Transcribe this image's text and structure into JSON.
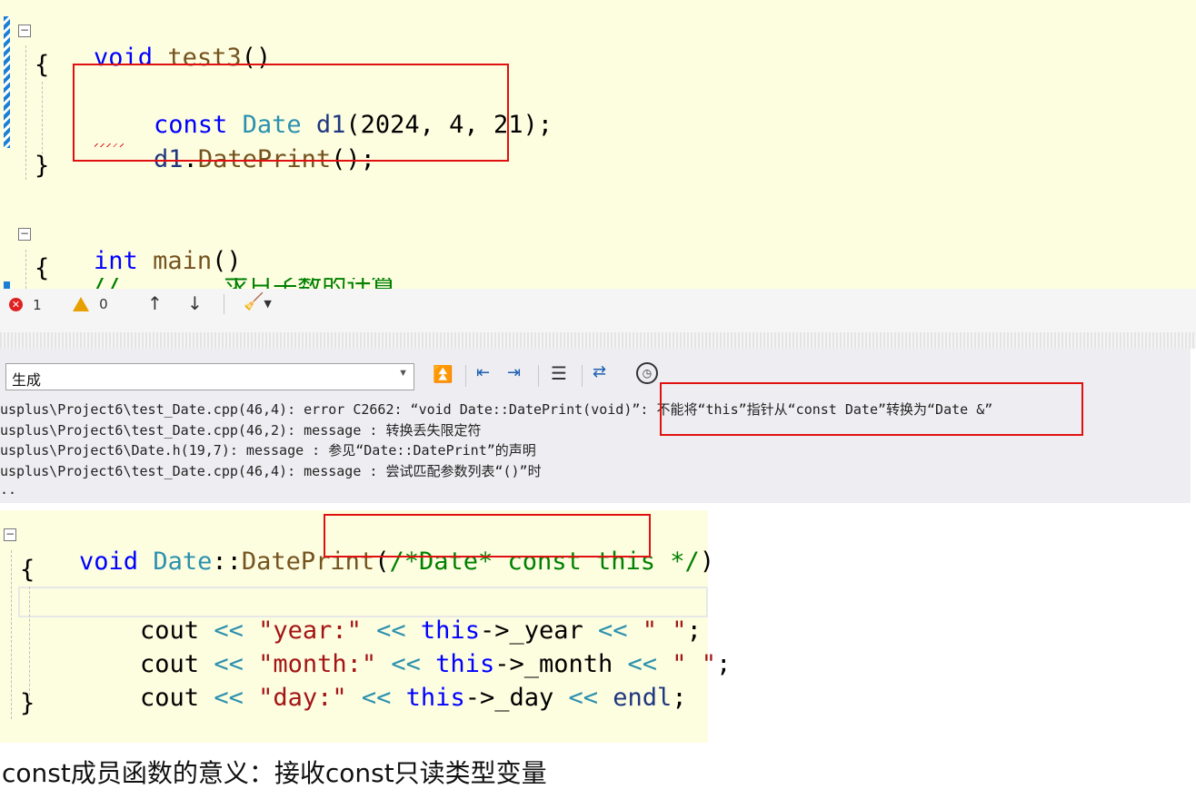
{
  "editor_top": {
    "lines": {
      "l1": {
        "kw": "void",
        "name": "test3",
        "rest": "()"
      },
      "l2": "{",
      "l3": {
        "kw": "const",
        "type": "Date",
        "var": "d1",
        "args": "(2024, 4, 21);"
      },
      "l4": {
        "var": "d1",
        "dot": ".",
        "fn": "DatePrint",
        "rest": "();"
      },
      "l5": "}",
      "l6": {
        "kw": "int",
        "name": "main",
        "rest": "()"
      },
      "l7": "{",
      "l8": "//  ...  求日子数的计算"
    }
  },
  "error_toolbar": {
    "error_count": "1",
    "warning_count": "0"
  },
  "output_panel": {
    "source_dropdown": "生成",
    "rows": [
      "usplus\\Project6\\test_Date.cpp(46,4): error C2662: “void Date::DatePrint(void)”: 不能将“this”指针从“const Date”转换为“Date &”",
      "usplus\\Project6\\test_Date.cpp(46,2): message : 转换丢失限定符",
      "usplus\\Project6\\Date.h(19,7): message : 参见“Date::DatePrint”的声明",
      "usplus\\Project6\\test_Date.cpp(46,4): message : 尝试匹配参数列表“()”时",
      ".."
    ]
  },
  "editor_bottom": {
    "l1": {
      "kw": "void",
      "type": "Date",
      "sep": "::",
      "fn": "DatePrint",
      "open": "(",
      "comment": "/*Date* const this */",
      "close": ")"
    },
    "l2": "{",
    "l3": {
      "a": "cout",
      "op1": " << ",
      "s": "\"year:\"",
      "op2": " << ",
      "kw": "this",
      "m": "->_year",
      "op3": " << ",
      "s2": "\" \"",
      "end": ";"
    },
    "l4": {
      "a": "cout",
      "op1": " << ",
      "s": "\"month:\"",
      "op2": " << ",
      "kw": "this",
      "m": "->_month",
      "op3": " << ",
      "s2": "\" \"",
      "end": ";"
    },
    "l5": {
      "a": "cout",
      "op1": " << ",
      "s": "\"day:\"",
      "op2": " << ",
      "kw": "this",
      "m": "->_day",
      "op3": " << ",
      "e": "endl",
      "end": ";"
    },
    "l6": "}"
  },
  "caption": "const成员函数的意义：接收const只读类型变量",
  "colors": {
    "keyword": "#0000ff",
    "type": "#2b91af",
    "function": "#74531f",
    "string": "#a31515",
    "comment": "#008000",
    "highlight_box": "#e01010",
    "code_bg": "#fdfde0"
  }
}
